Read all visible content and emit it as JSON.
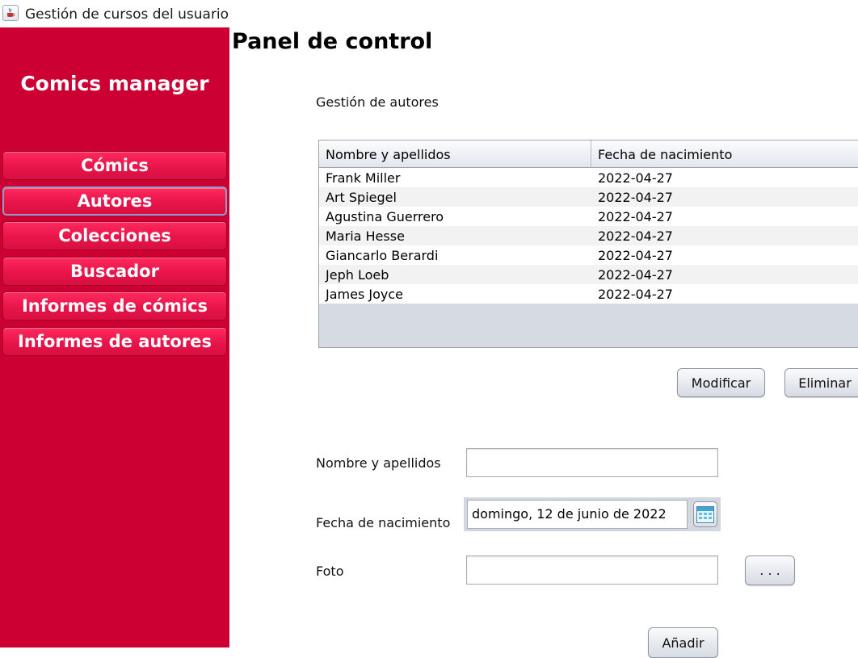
{
  "window": {
    "title": "Gestión de cursos del usuario",
    "icon": "java-cup-icon"
  },
  "sidebar": {
    "brand": "Comics manager",
    "color": "#cc0033",
    "items": [
      {
        "label": "Cómics",
        "active": false
      },
      {
        "label": "Autores",
        "active": true
      },
      {
        "label": "Colecciones",
        "active": false
      },
      {
        "label": "Buscador",
        "active": false
      },
      {
        "label": "Informes de cómics",
        "active": false
      },
      {
        "label": "Informes de autores",
        "active": false
      }
    ]
  },
  "main": {
    "heading": "Panel de control",
    "section_title": "Gestión de autores",
    "table": {
      "columns": [
        "Nombre y apellidos",
        "Fecha de nacimiento"
      ],
      "rows": [
        [
          "Frank Miller",
          "2022-04-27"
        ],
        [
          "Art Spiegel",
          "2022-04-27"
        ],
        [
          "Agustina Guerrero",
          "2022-04-27"
        ],
        [
          "Maria Hesse",
          "2022-04-27"
        ],
        [
          "Giancarlo Berardi",
          "2022-04-27"
        ],
        [
          "Jeph Loeb",
          "2022-04-27"
        ],
        [
          "James Joyce",
          "2022-04-27"
        ]
      ]
    },
    "actions": {
      "modify_label": "Modificar",
      "delete_label": "Eliminar"
    },
    "form": {
      "name_label": "Nombre y apellidos",
      "name_value": "",
      "birth_label": "Fecha de nacimiento",
      "birth_value": "domingo, 12 de junio de 2022",
      "calendar_icon": "calendar-icon",
      "photo_label": "Foto",
      "photo_value": "",
      "browse_label": ". . .",
      "add_label": "Añadir"
    }
  }
}
